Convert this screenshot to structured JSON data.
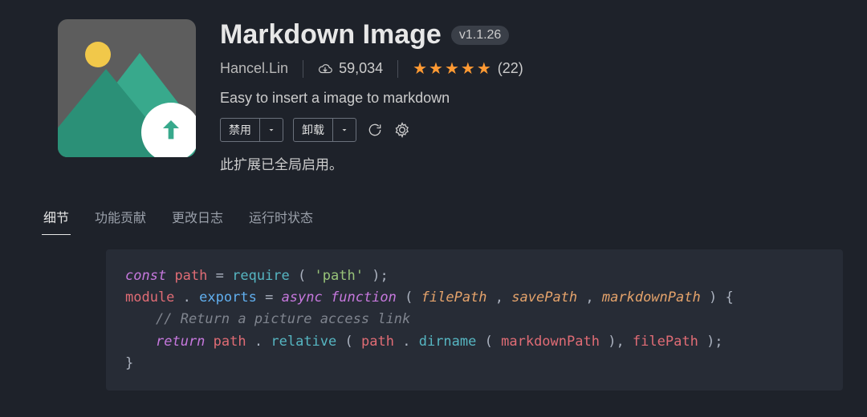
{
  "extension": {
    "title": "Markdown Image",
    "version": "v1.1.26",
    "author": "Hancel.Lin",
    "installs": "59,034",
    "rating_stars": "★★★★★",
    "review_count": "(22)",
    "description": "Easy to insert a image to markdown",
    "status_message": "此扩展已全局启用。"
  },
  "actions": {
    "disable_label": "禁用",
    "uninstall_label": "卸载"
  },
  "tabs": {
    "details": "细节",
    "contrib": "功能贡献",
    "changelog": "更改日志",
    "runtime": "运行时状态"
  },
  "code": {
    "l1": {
      "kw1": "const",
      "var1": "path",
      "pn1": " = ",
      "fn1": "require",
      "pn2": "(",
      "str1": "'path'",
      "pn3": ");"
    },
    "l2": {
      "var1": "module",
      "pn1": ".",
      "blue1": "exports",
      "pn2": " = ",
      "kw1": "async",
      "sp": " ",
      "kw2": "function",
      "pn3": "(",
      "p1": "filePath",
      "c1": ", ",
      "p2": "savePath",
      "c2": ", ",
      "p3": "markdownPath",
      "pn4": ") {"
    },
    "l3": {
      "cmt": "// Return a picture access link"
    },
    "l4": {
      "kw1": "return",
      "sp": " ",
      "var1": "path",
      "pn1": ".",
      "fn1": "relative",
      "pn2": "(",
      "var2": "path",
      "pn3": ".",
      "fn2": "dirname",
      "pn4": "(",
      "var3": "markdownPath",
      "pn5": "), ",
      "var4": "filePath",
      "pn6": ");"
    },
    "l5": {
      "pn1": "}"
    }
  }
}
